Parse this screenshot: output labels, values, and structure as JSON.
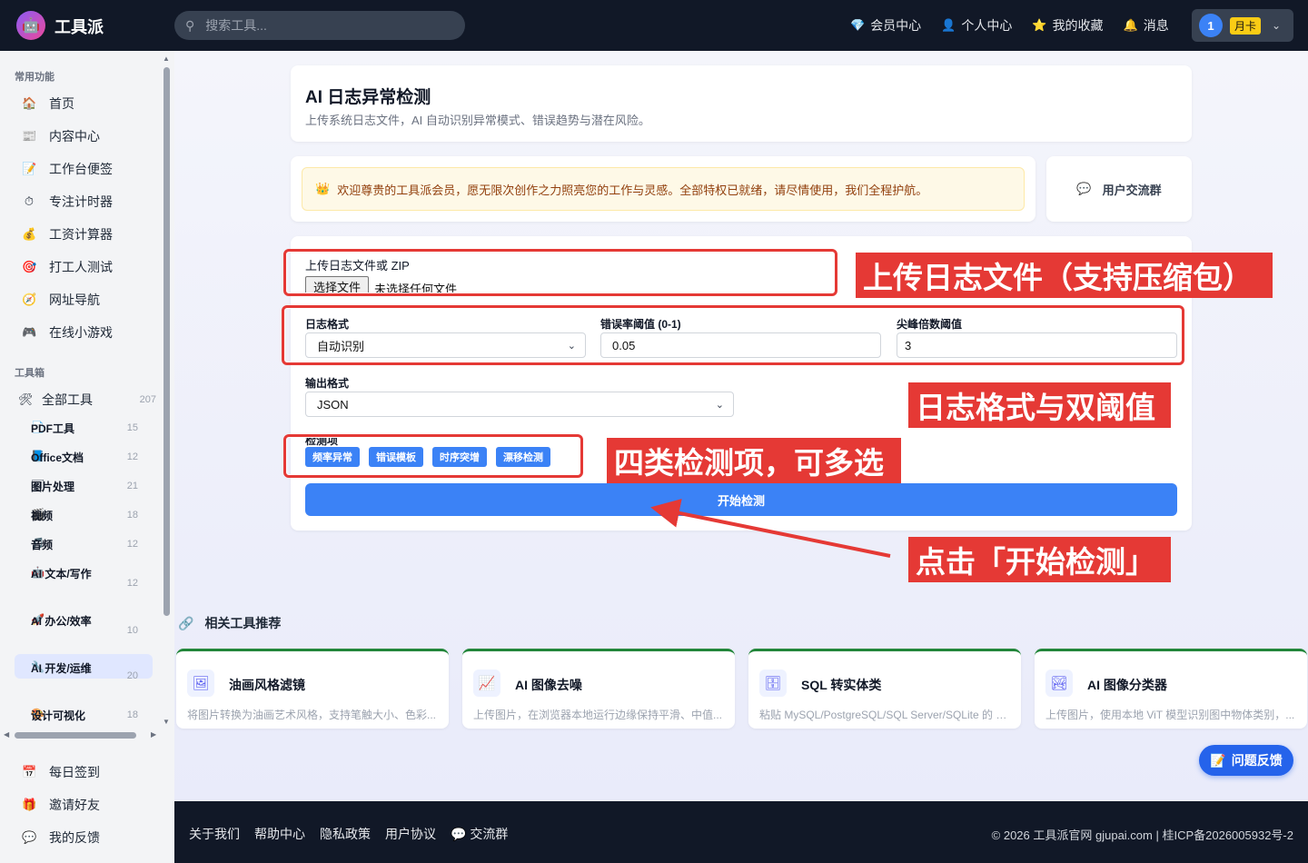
{
  "app": {
    "brand": "工具派",
    "logo_icon": "🤖",
    "search_placeholder": "搜索工具...",
    "nav": [
      {
        "icon": "💎",
        "label": "会员中心"
      },
      {
        "icon": "👤",
        "label": "个人中心"
      },
      {
        "icon": "⭐",
        "label": "我的收藏"
      },
      {
        "icon": "🔔",
        "label": "消息"
      }
    ],
    "user": {
      "avatar": "1",
      "plan": "月卡"
    }
  },
  "sidebar": {
    "common_title": "常用功能",
    "common": [
      {
        "icon": "🏠",
        "label": "首页"
      },
      {
        "icon": "📰",
        "label": "内容中心"
      },
      {
        "icon": "📝",
        "label": "工作台便签"
      },
      {
        "icon": "⏱",
        "label": "专注计时器"
      },
      {
        "icon": "💰",
        "label": "工资计算器"
      },
      {
        "icon": "🎯",
        "label": "打工人测试"
      },
      {
        "icon": "🧭",
        "label": "网址导航"
      },
      {
        "icon": "🎮",
        "label": "在线小游戏"
      }
    ],
    "toolbox_title": "工具箱",
    "all_tools": {
      "icon": "🛠",
      "label": "全部工具",
      "count": "207"
    },
    "categories": [
      {
        "icon": "📄",
        "label": "PDF工具",
        "count": "15"
      },
      {
        "icon": "📘",
        "label": "Office文档",
        "count": "12"
      },
      {
        "icon": "🖼",
        "label": "图片处理",
        "count": "21"
      },
      {
        "icon": "🎬",
        "label": "视频",
        "count": "18"
      },
      {
        "icon": "🎵",
        "label": "音频",
        "count": "12"
      },
      {
        "icon": "🤖",
        "label": "AI 文本/写作",
        "count": "12"
      },
      {
        "icon": "🚀",
        "label": "AI 办公/效率",
        "count": "10"
      },
      {
        "icon": "🔧",
        "label": "AI 开发/运维",
        "count": "20"
      },
      {
        "icon": "🎨",
        "label": "设计可视化",
        "count": "18"
      }
    ],
    "bottom": [
      {
        "icon": "📅",
        "label": "每日签到"
      },
      {
        "icon": "🎁",
        "label": "邀请好友"
      },
      {
        "icon": "💬",
        "label": "我的反馈"
      }
    ]
  },
  "page": {
    "title": "AI 日志异常检测",
    "subtitle": "上传系统日志文件，AI 自动识别异常模式、错误趋势与潜在风险。",
    "welcome_icon": "👑",
    "welcome": "欢迎尊贵的工具派会员，愿无限次创作之力照亮您的工作与灵感。全部特权已就绪，请尽情使用，我们全程护航。",
    "group_icon": "💬",
    "group": "用户交流群"
  },
  "form": {
    "upload_label": "上传日志文件或 ZIP",
    "file_button": "选择文件",
    "file_status": "未选择任何文件",
    "log_format_label": "日志格式",
    "log_format_value": "自动识别",
    "error_threshold_label": "错误率阈值 (0-1)",
    "error_threshold_value": "0.05",
    "spike_threshold_label": "尖峰倍数阈值",
    "spike_threshold_value": "3",
    "output_label": "输出格式",
    "output_value": "JSON",
    "checks_label": "检测项",
    "checks": [
      "频率异常",
      "错误模板",
      "时序突增",
      "漂移检测"
    ],
    "start_button": "开始检测"
  },
  "annotations": {
    "upload": "上传日志文件（支持压缩包）",
    "format": "日志格式与双阈值",
    "checks": "四类检测项，可多选",
    "start": "点击「开始检测」",
    "color": "#e53935"
  },
  "related": {
    "title": "相关工具推荐",
    "title_icon": "🔗",
    "items": [
      {
        "icon": "🖼",
        "name": "油画风格滤镜",
        "desc": "将图片转换为油画艺术风格，支持笔触大小、色彩..."
      },
      {
        "icon": "📈",
        "name": "AI 图像去噪",
        "desc": "上传图片，在浏览器本地运行边缘保持平滑、中值..."
      },
      {
        "icon": "🗄",
        "name": "SQL 转实体类",
        "desc": "粘贴 MySQL/PostgreSQL/SQL Server/SQLite 的 CR..."
      },
      {
        "icon": "🏞",
        "name": "AI 图像分类器",
        "desc": "上传图片，使用本地 ViT 模型识别图中物体类别，..."
      }
    ]
  },
  "feedback": {
    "icon": "📝",
    "label": "问题反馈"
  },
  "footer": {
    "links": [
      "关于我们",
      "帮助中心",
      "隐私政策",
      "用户协议",
      "💬 交流群"
    ],
    "copyright": "© 2026 工具派官网 gjupai.com | 桂ICP备2026005932号-2"
  }
}
